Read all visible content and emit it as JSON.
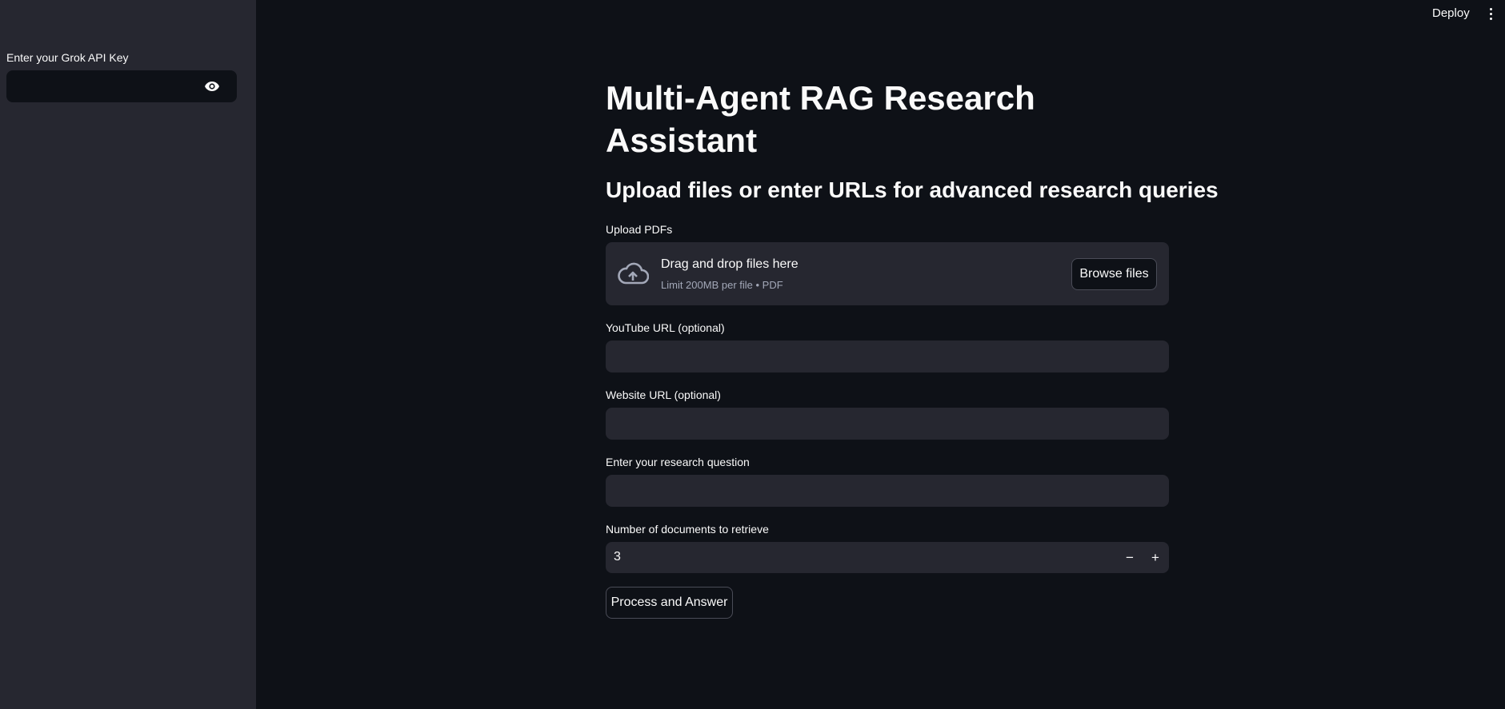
{
  "header": {
    "deploy_label": "Deploy",
    "menu_icon": "vertical-dots-icon"
  },
  "sidebar": {
    "api_key_label": "Enter your Grok API Key",
    "api_key_value": "",
    "eye_icon": "eye-icon"
  },
  "main": {
    "title": "Multi-Agent RAG Research Assistant",
    "subtitle": "Upload files or enter URLs for advanced research queries",
    "upload": {
      "label": "Upload PDFs",
      "drag_text": "Drag and drop files here",
      "limit_text": "Limit 200MB per file • PDF",
      "browse_label": "Browse files",
      "icon": "cloud-upload-icon"
    },
    "youtube": {
      "label": "YouTube URL (optional)",
      "value": ""
    },
    "website": {
      "label": "Website URL (optional)",
      "value": ""
    },
    "question": {
      "label": "Enter your research question",
      "value": ""
    },
    "num_docs": {
      "label": "Number of documents to retrieve",
      "value": "3",
      "minus": "−",
      "plus": "+"
    },
    "process_label": "Process and Answer"
  }
}
